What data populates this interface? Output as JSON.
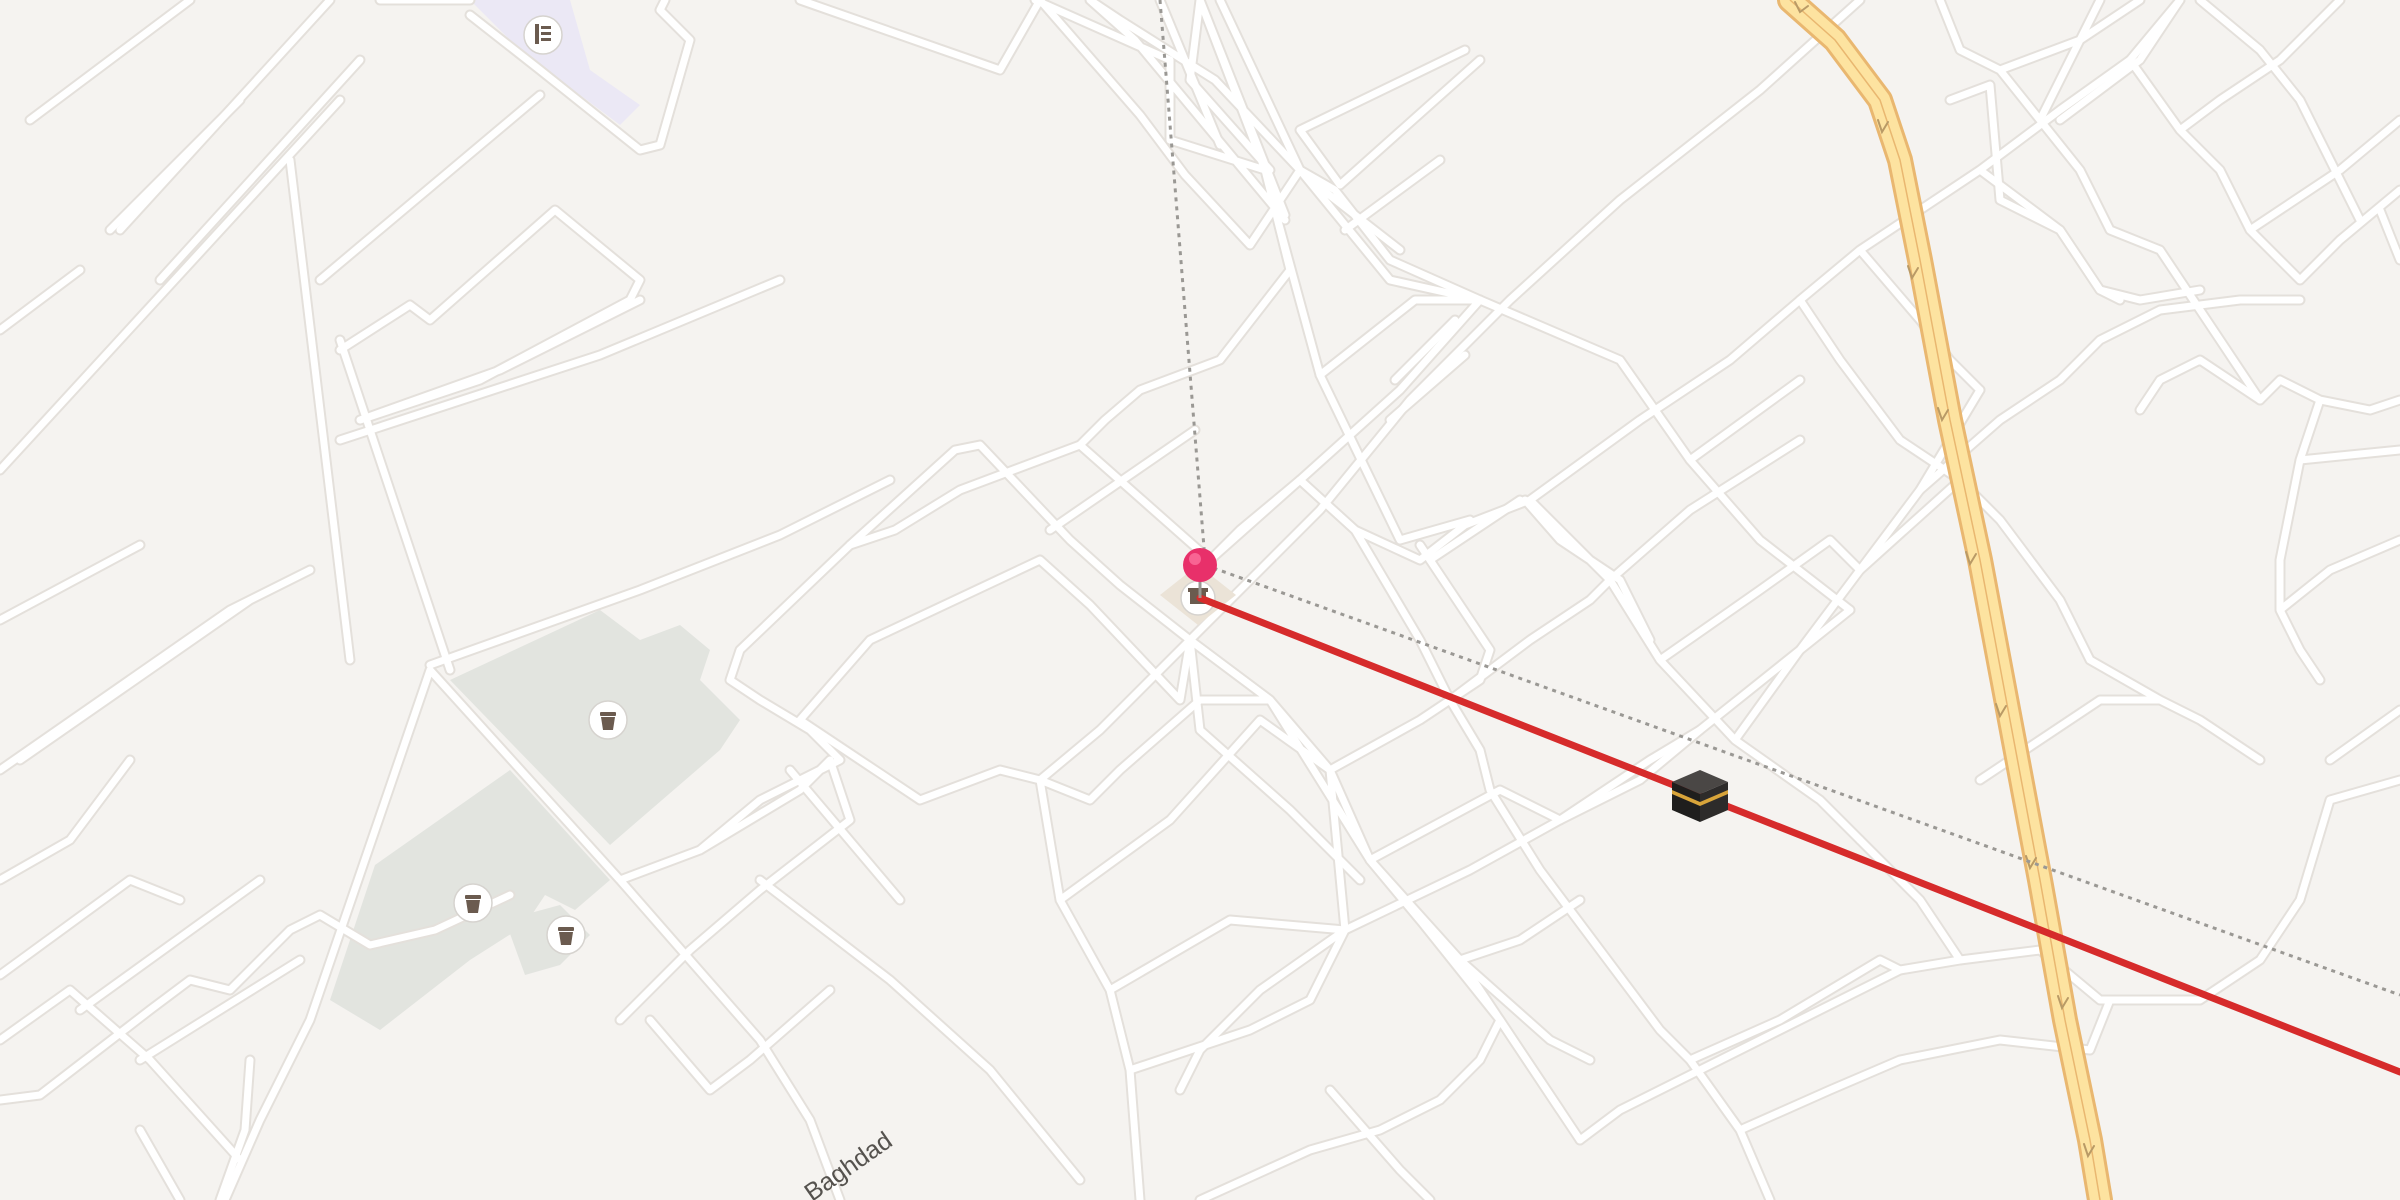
{
  "map": {
    "street_labels": [
      {
        "text": "Baghdad"
      }
    ],
    "poi_markers": [
      {
        "icon": "cemetery-icon"
      },
      {
        "icon": "cemetery-icon"
      },
      {
        "icon": "cemetery-icon"
      },
      {
        "icon": "cemetery-icon"
      },
      {
        "icon": "museum-icon"
      }
    ],
    "selected_pin": {
      "icon": "location-pin-icon",
      "color": "#e8306a"
    },
    "qibla_marker": {
      "icon": "kaaba-icon"
    },
    "qibla_line_color": "#d62b2b",
    "reference_line_color": "#9a9894",
    "colors": {
      "background": "#f5f3f0",
      "road": "#ffffff",
      "highway": "#fde3a0",
      "highway_casing": "#e9b770",
      "park": "#e2e4df",
      "restricted_area": "#ebe8f5"
    }
  }
}
